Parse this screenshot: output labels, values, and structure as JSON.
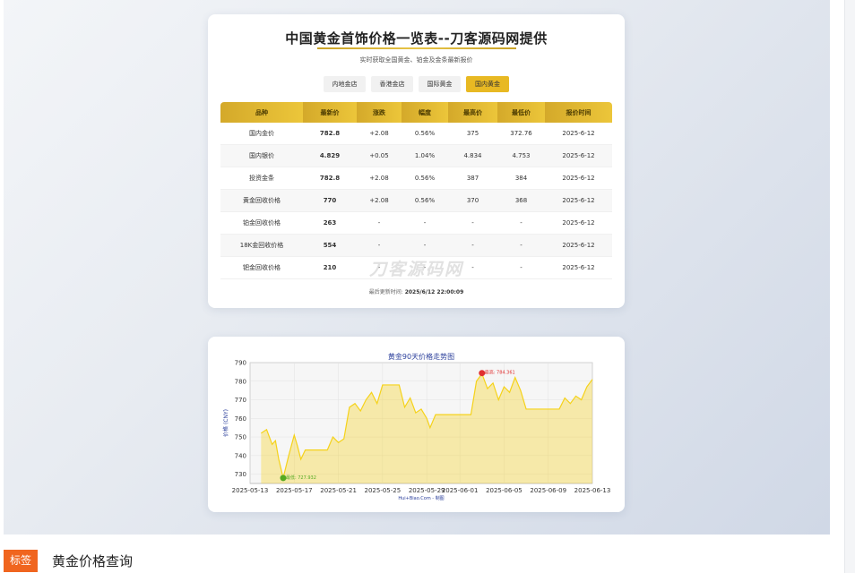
{
  "page": {
    "title": "中国黄金首饰价格一览表--刀客源码网提供",
    "subtitle": "实时获取全国黄金、铂金及金条最新报价",
    "tabs": [
      {
        "label": "内地金店",
        "active": false
      },
      {
        "label": "香港金店",
        "active": false
      },
      {
        "label": "国际黄金",
        "active": false
      },
      {
        "label": "国内黄金",
        "active": true
      }
    ],
    "table": {
      "headers": [
        "品种",
        "最新价",
        "涨跌",
        "幅度",
        "最高价",
        "最低价",
        "报价时间"
      ],
      "rows": [
        [
          "国内金价",
          "782.8",
          "+2.08",
          "0.56%",
          "375",
          "372.76",
          "2025-6-12"
        ],
        [
          "国内银价",
          "4.829",
          "+0.05",
          "1.04%",
          "4.834",
          "4.753",
          "2025-6-12"
        ],
        [
          "投资金条",
          "782.8",
          "+2.08",
          "0.56%",
          "387",
          "384",
          "2025-6-12"
        ],
        [
          "黄金回收价格",
          "770",
          "+2.08",
          "0.56%",
          "370",
          "368",
          "2025-6-12"
        ],
        [
          "铂金回收价格",
          "263",
          "-",
          "-",
          "-",
          "-",
          "2025-6-12"
        ],
        [
          "18K金回收价格",
          "554",
          "-",
          "-",
          "-",
          "-",
          "2025-6-12"
        ],
        [
          "钯金回收价格",
          "210",
          "-",
          "-",
          "-",
          "-",
          "2025-6-12"
        ]
      ]
    },
    "watermark": "刀客源码网",
    "updated_label": "最后更新时间:",
    "updated_value": "2025/6/12 22:00:09"
  },
  "chart_data": {
    "type": "area",
    "title": "黄金90天价格走势图",
    "ylabel": "价格 (CNY)",
    "footer": "Hui+Biao.Com - 制图",
    "xlim": [
      "2025-05-13",
      "2025-06-13"
    ],
    "ylim": [
      725,
      790
    ],
    "yticks": [
      730,
      740,
      750,
      760,
      770,
      780,
      790
    ],
    "xticks": [
      "2025-05-13",
      "2025-05-17",
      "2025-05-21",
      "2025-05-25",
      "2025-05-29",
      "2025-06-01",
      "2025-06-05",
      "2025-06-09",
      "2025-06-13"
    ],
    "grid": true,
    "series": [
      {
        "color": "#f5d21a",
        "points": [
          [
            "2025-05-14",
            752
          ],
          [
            "2025-05-14.5",
            754
          ],
          [
            "2025-05-15",
            746
          ],
          [
            "2025-05-15.3",
            748
          ],
          [
            "2025-05-15.6",
            738
          ],
          [
            "2025-05-16",
            728
          ],
          [
            "2025-05-16.5",
            740
          ],
          [
            "2025-05-17",
            751
          ],
          [
            "2025-05-17.3",
            745
          ],
          [
            "2025-05-17.6",
            738
          ],
          [
            "2025-05-18",
            743
          ],
          [
            "2025-05-19",
            743
          ],
          [
            "2025-05-20",
            743
          ],
          [
            "2025-05-20.5",
            750
          ],
          [
            "2025-05-21",
            747
          ],
          [
            "2025-05-21.5",
            749
          ],
          [
            "2025-05-22",
            766
          ],
          [
            "2025-05-22.5",
            768
          ],
          [
            "2025-05-23",
            764
          ],
          [
            "2025-05-23.5",
            770
          ],
          [
            "2025-05-24",
            774
          ],
          [
            "2025-05-24.5",
            768
          ],
          [
            "2025-05-25",
            778
          ],
          [
            "2025-05-26",
            778
          ],
          [
            "2025-05-26.5",
            778
          ],
          [
            "2025-05-27",
            766
          ],
          [
            "2025-05-27.5",
            771
          ],
          [
            "2025-05-28",
            763
          ],
          [
            "2025-05-28.5",
            765
          ],
          [
            "2025-05-29",
            760
          ],
          [
            "2025-05-29.3",
            755
          ],
          [
            "2025-05-29.8",
            762
          ],
          [
            "2025-05-30",
            762
          ],
          [
            "2025-05-31",
            762
          ],
          [
            "2025-06-01",
            762
          ],
          [
            "2025-06-02",
            762
          ],
          [
            "2025-06-02.5",
            780
          ],
          [
            "2025-06-03",
            784
          ],
          [
            "2025-06-03.5",
            776
          ],
          [
            "2025-06-04",
            779
          ],
          [
            "2025-06-04.5",
            770
          ],
          [
            "2025-06-05",
            777
          ],
          [
            "2025-06-05.5",
            774
          ],
          [
            "2025-06-06",
            782
          ],
          [
            "2025-06-06.5",
            775
          ],
          [
            "2025-06-07",
            765
          ],
          [
            "2025-06-08",
            765
          ],
          [
            "2025-06-09",
            765
          ],
          [
            "2025-06-10",
            765
          ],
          [
            "2025-06-10.5",
            771
          ],
          [
            "2025-06-11",
            768
          ],
          [
            "2025-06-11.5",
            772
          ],
          [
            "2025-06-12",
            770
          ],
          [
            "2025-06-12.5",
            777
          ],
          [
            "2025-06-13",
            781
          ]
        ]
      }
    ],
    "annotations": [
      {
        "label": "最高: 784.361",
        "x": "2025-06-03",
        "y": 784.361,
        "color": "#e03030"
      },
      {
        "label": "最低: 727.932",
        "x": "2025-05-16",
        "y": 727.932,
        "color": "#55aa22"
      }
    ]
  },
  "bottom": {
    "badge": "标签",
    "tag": "黄金价格查询"
  }
}
